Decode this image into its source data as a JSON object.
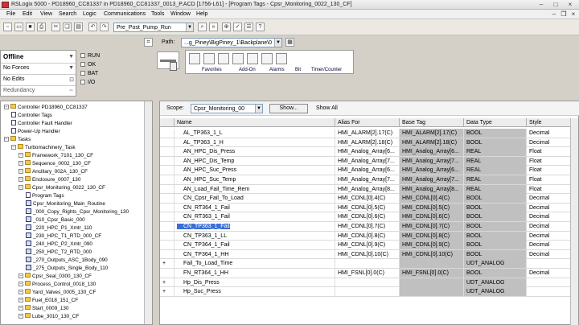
{
  "window": {
    "title": "RSLogix 5000 - PD18960_CC81337 in PD18960_CC81337_0013_P.ACD [1756-L61] - [Program Tags - Cpsr_Monitoring_0022_130_CF]",
    "min": "–",
    "max": "□",
    "close": "×"
  },
  "menu": {
    "items": [
      "File",
      "Edit",
      "View",
      "Search",
      "Logic",
      "Communications",
      "Tools",
      "Window",
      "Help"
    ]
  },
  "toolbar": {
    "routine_combo": "Pre_Post_Pump_Run",
    "path_label": "Path:",
    "path_value": "...g_Piney\\BigPiney_1\\Backplane\\0"
  },
  "status": {
    "mode": "Offline",
    "forces": "No Forces",
    "edits": "No Edits",
    "redundancy": "Redundancy",
    "indicators": [
      "RUN",
      "OK",
      "BAT",
      "I/O"
    ]
  },
  "instruction_tabs": [
    "Favorites",
    "Add-On",
    "Alarms",
    "Bit",
    "Timer/Counter"
  ],
  "tree": [
    {
      "depth": 0,
      "type": "pm-fld",
      "label": "Controller PD18960_CC81337"
    },
    {
      "depth": 1,
      "type": "doc",
      "label": "Controller Tags"
    },
    {
      "depth": 1,
      "type": "doc",
      "label": "Controller Fault Handler"
    },
    {
      "depth": 1,
      "type": "doc",
      "label": "Power-Up Handler"
    },
    {
      "depth": 0,
      "type": "pm-fld",
      "label": "Tasks"
    },
    {
      "depth": 1,
      "type": "pm-fld",
      "label": "Turbomachinery_Task"
    },
    {
      "depth": 2,
      "type": "pm-fld",
      "label": "Framework_7101_130_CF"
    },
    {
      "depth": 2,
      "type": "pm-fld",
      "label": "Sequence_0002_130_CF"
    },
    {
      "depth": 2,
      "type": "pm-fld",
      "label": "Ancillary_002A_130_CF"
    },
    {
      "depth": 2,
      "type": "pm-fld",
      "label": "Enclosure_0007_130"
    },
    {
      "depth": 2,
      "type": "pm-fld",
      "label": "Cpsr_Monitoring_0022_130_CF"
    },
    {
      "depth": 3,
      "type": "doc",
      "label": "Program Tags"
    },
    {
      "depth": 3,
      "type": "lad",
      "label": "Cpsr_Monitoring_Main_Routine"
    },
    {
      "depth": 3,
      "type": "lad",
      "label": "_000_Copy_Rights_Cpsr_Monitoring_130"
    },
    {
      "depth": 3,
      "type": "lad",
      "label": "_010_Cpsr_Basic_000"
    },
    {
      "depth": 3,
      "type": "lad",
      "label": "_220_HPC_P1_Xmtr_110"
    },
    {
      "depth": 3,
      "type": "lad",
      "label": "_230_HPC_T1_RTD_000_CF"
    },
    {
      "depth": 3,
      "type": "lad",
      "label": "_240_HPC_P2_Xmtr_090"
    },
    {
      "depth": 3,
      "type": "lad",
      "label": "_250_HPC_T2_RTD_000"
    },
    {
      "depth": 3,
      "type": "lad",
      "label": "_270_Outputs_ASC_1Body_090"
    },
    {
      "depth": 3,
      "type": "lad",
      "label": "_275_Outputs_Single_Body_110"
    },
    {
      "depth": 2,
      "type": "pm-fld",
      "label": "Cpsr_Seal_0300_130_CF"
    },
    {
      "depth": 2,
      "type": "pm-fld",
      "label": "Process_Control_0018_130"
    },
    {
      "depth": 2,
      "type": "pm-fld",
      "label": "Yard_Valves_0005_130_CF"
    },
    {
      "depth": 2,
      "type": "pm-fld",
      "label": "Fuel_E018_151_CF"
    },
    {
      "depth": 2,
      "type": "pm-fld",
      "label": "Start_0009_130"
    },
    {
      "depth": 2,
      "type": "pm-fld",
      "label": "Lube_3010_130_CF"
    }
  ],
  "tags_view": {
    "scope_label": "Scope:",
    "scope_value": "Cpsr_Monitoring_00",
    "show_label": "Show...",
    "show_all": "Show All",
    "columns": [
      "Name",
      "Alias For",
      "Base Tag",
      "Data Type",
      "Style"
    ],
    "rows": [
      {
        "expand": "",
        "name": "AL_TP363_1_L",
        "alias": "HMI_ALARM[2].17(C)",
        "base": "HMI_ALARM[2].17(C)",
        "type": "BOOL",
        "style": "Decimal"
      },
      {
        "expand": "",
        "name": "AL_TP363_1_H",
        "alias": "HMI_ALARM[2].18(C)",
        "base": "HMI_ALARM[2].18(C)",
        "type": "BOOL",
        "style": "Decimal"
      },
      {
        "expand": "",
        "name": "AN_HPC_Dis_Press",
        "alias": "HMI_Analog_Array[6...",
        "base": "HMI_Analog_Array[6...",
        "type": "REAL",
        "style": "Float"
      },
      {
        "expand": "",
        "name": "AN_HPC_Dis_Temp",
        "alias": "HMI_Analog_Array[7...",
        "base": "HMI_Analog_Array[7...",
        "type": "REAL",
        "style": "Float"
      },
      {
        "expand": "",
        "name": "AN_HPC_Suc_Press",
        "alias": "HMI_Analog_Array[6...",
        "base": "HMI_Analog_Array[6...",
        "type": "REAL",
        "style": "Float"
      },
      {
        "expand": "",
        "name": "AN_HPC_Suc_Temp",
        "alias": "HMI_Analog_Array[7...",
        "base": "HMI_Analog_Array[7...",
        "type": "REAL",
        "style": "Float"
      },
      {
        "expand": "",
        "name": "AN_Load_Fail_Time_Rem",
        "alias": "HMI_Analog_Array[8...",
        "base": "HMI_Analog_Array[8...",
        "type": "REAL",
        "style": "Float"
      },
      {
        "expand": "",
        "name": "CN_Cpsr_Fail_To_Load",
        "alias": "HMI_CDNL[0].4(C)",
        "base": "HMI_CDNL[0].4(C)",
        "type": "BOOL",
        "style": "Decimal"
      },
      {
        "expand": "",
        "name": "CN_RT364_1_Fail",
        "alias": "HMI_CDNL[0].5(C)",
        "base": "HMI_CDNL[0].5(C)",
        "type": "BOOL",
        "style": "Decimal"
      },
      {
        "expand": "",
        "name": "CN_RT363_1_Fail",
        "alias": "HMI_CDNL[0].6(C)",
        "base": "HMI_CDNL[0].6(C)",
        "type": "BOOL",
        "style": "Decimal"
      },
      {
        "expand": "",
        "name": "CN_TP363_1_Fail",
        "alias": "HMI_CDNL[0].7(C)",
        "base": "HMI_CDNL[0].7(C)",
        "type": "BOOL",
        "style": "Decimal",
        "selected": true
      },
      {
        "expand": "",
        "name": "CN_TP363_1_LL",
        "alias": "HMI_CDNL[0].8(C)",
        "base": "HMI_CDNL[0].8(C)",
        "type": "BOOL",
        "style": "Decimal"
      },
      {
        "expand": "",
        "name": "CN_TP364_1_Fail",
        "alias": "HMI_CDNL[0].9(C)",
        "base": "HMI_CDNL[0].9(C)",
        "type": "BOOL",
        "style": "Decimal"
      },
      {
        "expand": "",
        "name": "CN_TP364_1_HH",
        "alias": "HMI_CDNL[0].10(C)",
        "base": "HMI_CDNL[0].10(C)",
        "type": "BOOL",
        "style": "Decimal"
      },
      {
        "expand": "+",
        "name": "Fail_To_Load_Time",
        "alias": "",
        "base": "",
        "type": "UDT_ANALOG",
        "style": ""
      },
      {
        "expand": "",
        "name": "FN_RT364_1_HH",
        "alias": "HMI_FSNL[0].0(C)",
        "base": "HMI_FSNL[0].0(C)",
        "type": "BOOL",
        "style": "Decimal"
      },
      {
        "expand": "+",
        "name": "Hp_Dis_Press",
        "alias": "",
        "base": "",
        "type": "UDT_ANALOG",
        "style": ""
      },
      {
        "expand": "+",
        "name": "Hp_Suc_Press",
        "alias": "",
        "base": "",
        "type": "UDT_ANALOG",
        "style": ""
      }
    ]
  }
}
